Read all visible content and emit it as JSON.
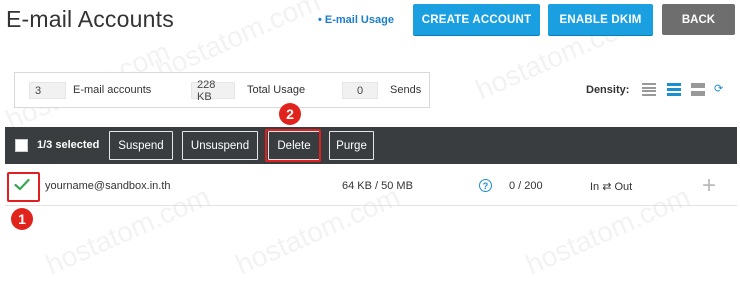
{
  "page": {
    "title": "E-mail Accounts",
    "usage_link": "E-mail Usage",
    "buttons": {
      "create": "CREATE ACCOUNT",
      "dkim": "ENABLE DKIM",
      "back": "BACK"
    }
  },
  "stats": {
    "accounts_count": "3",
    "accounts_label": "E-mail accounts",
    "usage_value": "228 KB",
    "usage_label": "Total Usage",
    "sends_value": "0",
    "sends_label": "Sends"
  },
  "density": {
    "label": "Density:",
    "options": [
      "compact",
      "normal",
      "comfortable",
      "auto"
    ]
  },
  "toolbar": {
    "selected_text": "1/3 selected",
    "suspend": "Suspend",
    "unsuspend": "Unsuspend",
    "delete": "Delete",
    "purge": "Purge"
  },
  "rows": [
    {
      "email": "yourname@sandbox.in.th",
      "size": "64 KB / 50 MB",
      "sends": "0 / 200",
      "direction": "In ⇄ Out",
      "checked": true
    }
  ],
  "annotations": {
    "marker1": "1",
    "marker2": "2"
  },
  "watermark": "hostatom.com",
  "colors": {
    "accent": "#1aa0e0",
    "toolbar_bg": "#3a3d40",
    "highlight": "#e02020"
  }
}
